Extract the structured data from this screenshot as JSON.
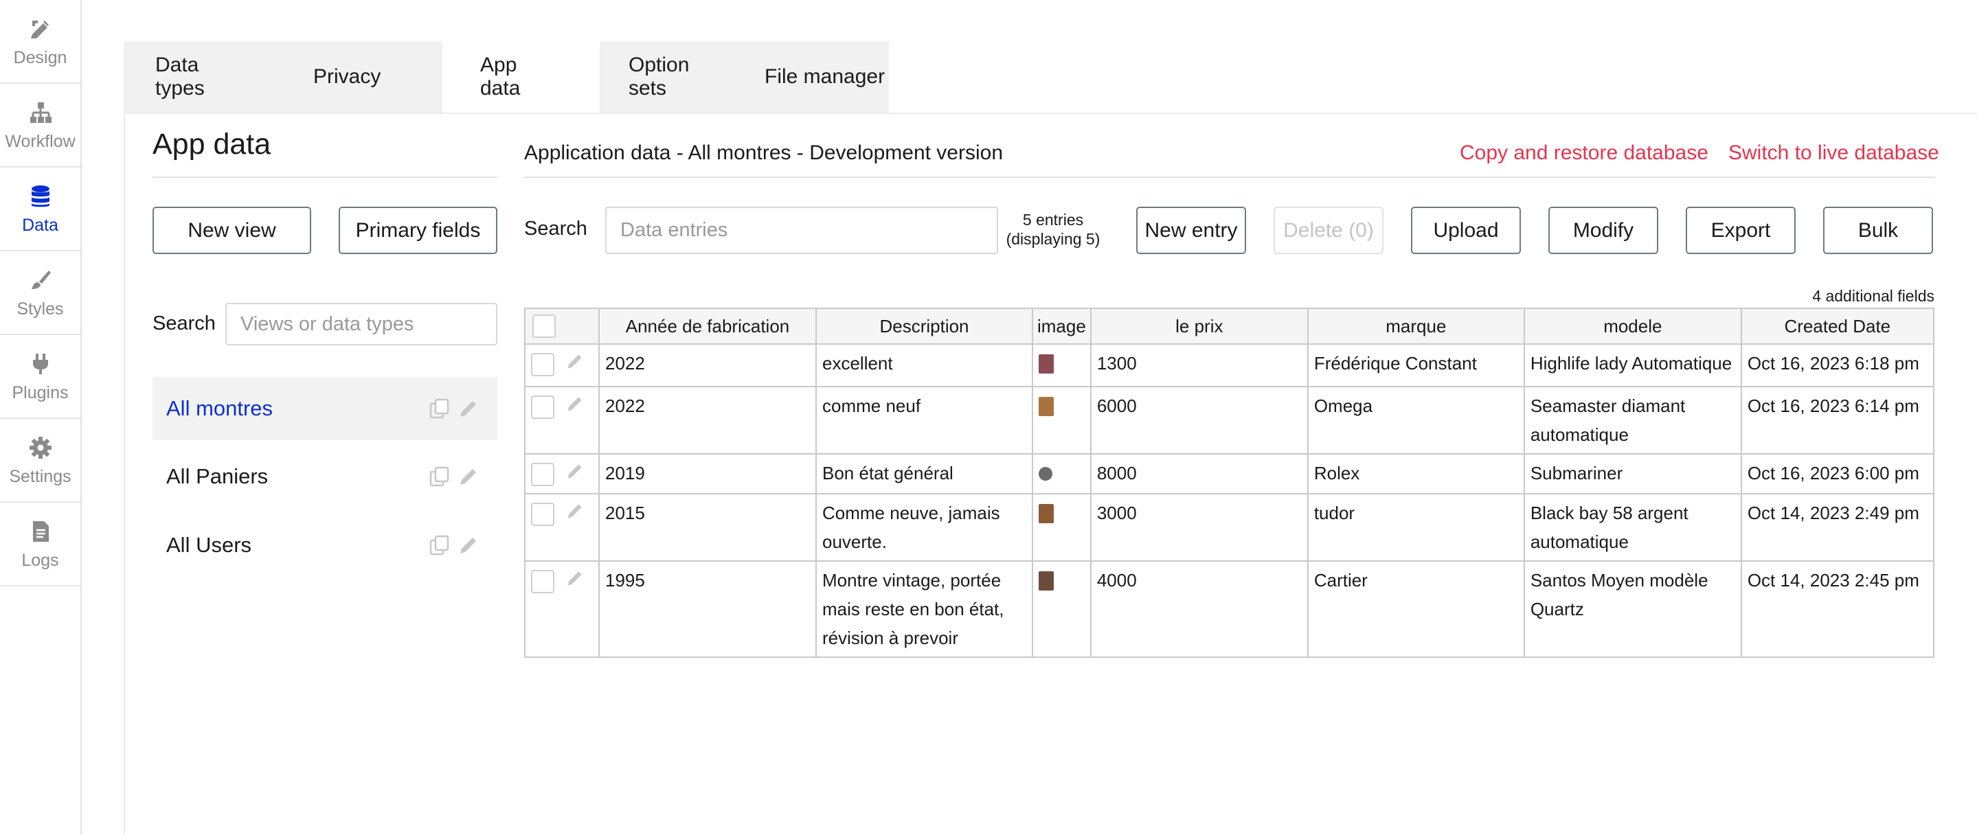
{
  "sidebar": {
    "items": [
      {
        "label": "Design",
        "icon": "design-icon"
      },
      {
        "label": "Workflow",
        "icon": "workflow-icon"
      },
      {
        "label": "Data",
        "icon": "database-icon"
      },
      {
        "label": "Styles",
        "icon": "brush-icon"
      },
      {
        "label": "Plugins",
        "icon": "plug-icon"
      },
      {
        "label": "Settings",
        "icon": "gear-icon"
      },
      {
        "label": "Logs",
        "icon": "document-icon"
      }
    ],
    "active_index": 2
  },
  "tabs": [
    {
      "label": "Data types"
    },
    {
      "label": "Privacy"
    },
    {
      "label": "App data"
    },
    {
      "label": "Option sets"
    },
    {
      "label": "File manager"
    }
  ],
  "left": {
    "title": "App data",
    "new_view_label": "New view",
    "primary_fields_label": "Primary fields",
    "search_label": "Search",
    "search_placeholder": "Views or data types",
    "views": [
      {
        "label": "All montres",
        "active": true
      },
      {
        "label": "All Paniers",
        "active": false
      },
      {
        "label": "All Users",
        "active": false
      }
    ]
  },
  "main": {
    "subtitle": "Application data - All montres - Development version",
    "copy_restore_label": "Copy and restore database",
    "switch_live_label": "Switch to live database",
    "search_label": "Search",
    "search_placeholder": "Data entries",
    "entries_count": "5 entries",
    "entries_displaying": "(displaying 5)",
    "new_entry_label": "New entry",
    "delete_label": "Delete (0)",
    "upload_label": "Upload",
    "modify_label": "Modify",
    "export_label": "Export",
    "bulk_label": "Bulk",
    "additional_fields": "4 additional fields"
  },
  "table": {
    "columns": [
      "Année de fabrication",
      "Description",
      "image",
      "le prix",
      "marque",
      "modele",
      "Created Date"
    ],
    "rows": [
      {
        "annee": "2022",
        "description": "excellent",
        "thumb_color": "#8a4b52",
        "prix": "1300",
        "marque": "Frédérique Constant",
        "modele": "Highlife lady Automatique",
        "created": "Oct 16, 2023 6:18 pm"
      },
      {
        "annee": "2022",
        "description": "comme neuf",
        "thumb_color": "#a8733f",
        "prix": "6000",
        "marque": "Omega",
        "modele": "Seamaster diamant automatique",
        "created": "Oct 16, 2023 6:14 pm"
      },
      {
        "annee": "2019",
        "description": "Bon état général",
        "thumb_color": "#6b6b6b",
        "prix": "8000",
        "marque": "Rolex",
        "modele": "Submariner",
        "created": "Oct 16, 2023 6:00 pm"
      },
      {
        "annee": "2015",
        "description": "Comme neuve, jamais ouverte.",
        "thumb_color": "#8c5a33",
        "prix": "3000",
        "marque": "tudor",
        "modele": "Black bay 58 argent automatique",
        "created": "Oct 14, 2023 2:49 pm"
      },
      {
        "annee": "1995",
        "description": "Montre vintage, portée mais reste en bon état, révision à prevoir",
        "thumb_color": "#6e4a3a",
        "prix": "4000",
        "marque": "Cartier",
        "modele": "Santos Moyen modèle Quartz",
        "created": "Oct 14, 2023 2:45 pm"
      }
    ]
  },
  "colors": {
    "accent_blue": "#0b2fd1",
    "link_red": "#e4344f",
    "muted_gray": "#8a8a8a"
  }
}
